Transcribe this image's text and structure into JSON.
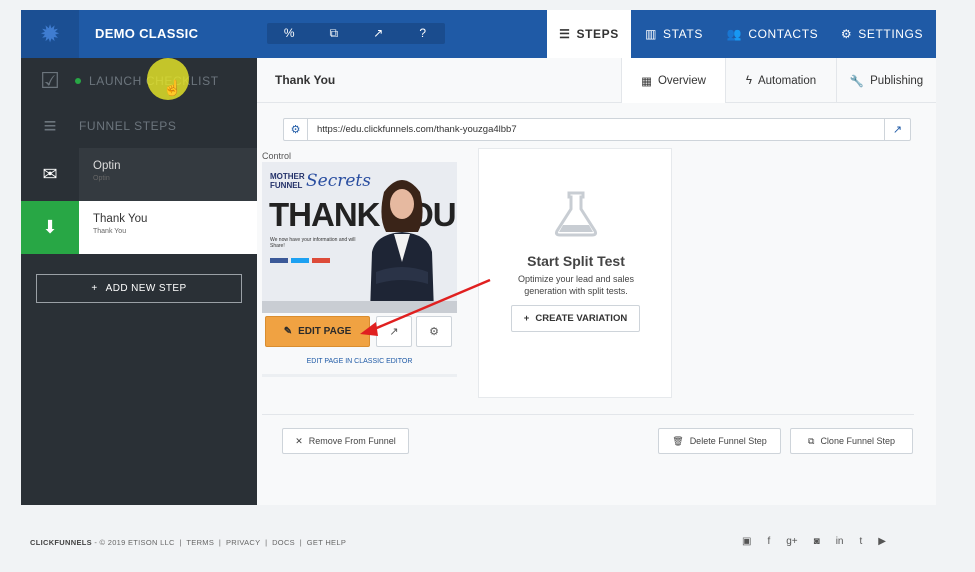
{
  "app": {
    "title": "DEMO CLASSIC",
    "logo_icon": "gear-icon",
    "toolbar_icons": [
      "link-icon",
      "copy-icon",
      "external-link-icon",
      "help-icon"
    ],
    "toolbar_glyphs": [
      "%",
      "⧉",
      "↗",
      "?"
    ]
  },
  "topnav": {
    "steps": "STEPS",
    "stats": "STATS",
    "contacts": "CONTACTS",
    "settings": "SETTINGS"
  },
  "sidebar": {
    "launch_checklist": "LAUNCH CHECKLIST",
    "funnel_steps": "FUNNEL STEPS",
    "steps": [
      {
        "title": "Optin",
        "subtitle": "Optin"
      },
      {
        "title": "Thank You",
        "subtitle": "Thank You"
      }
    ],
    "add_step": "ADD NEW STEP"
  },
  "main": {
    "page_title": "Thank You",
    "tabs": {
      "overview": "Overview",
      "automation": "Automation",
      "publishing": "Publishing"
    },
    "url": "https://edu.clickfunnels.com/thank-youzga4lbb7",
    "control_label": "Control",
    "preview": {
      "logo_line1": "MOTHER",
      "logo_line2": "FUNNEL",
      "logo_script": "Secrets",
      "headline": "THANK YOU",
      "body": "We now have your information and will Share!"
    },
    "edit_page": "EDIT PAGE",
    "edit_classic": "EDIT PAGE IN CLASSIC EDITOR",
    "split": {
      "title": "Start Split Test",
      "description": "Optimize your lead and sales generation with split tests.",
      "create": "CREATE VARIATION"
    },
    "remove_from_funnel": "Remove From Funnel",
    "delete_step": "Delete Funnel Step",
    "clone_step": "Clone Funnel Step"
  },
  "footer": {
    "brand": "CLICKFUNNELS",
    "copyright": "- © 2019 ETISON LLC",
    "links": [
      "TERMS",
      "PRIVACY",
      "DOCS",
      "GET HELP"
    ],
    "social_icons": [
      "blog-icon",
      "facebook-icon",
      "google-plus-icon",
      "instagram-icon",
      "linkedin-icon",
      "twitter-icon",
      "youtube-icon"
    ],
    "social_glyphs": [
      "▣",
      "f",
      "g+",
      "◙",
      "in",
      "t",
      "▶"
    ]
  },
  "colors": {
    "brand_blue": "#1f5aa6",
    "sidebar_dark": "#2a3036",
    "active_green": "#28a745",
    "edit_orange": "#f0a242",
    "annotation_red": "#e02020"
  }
}
